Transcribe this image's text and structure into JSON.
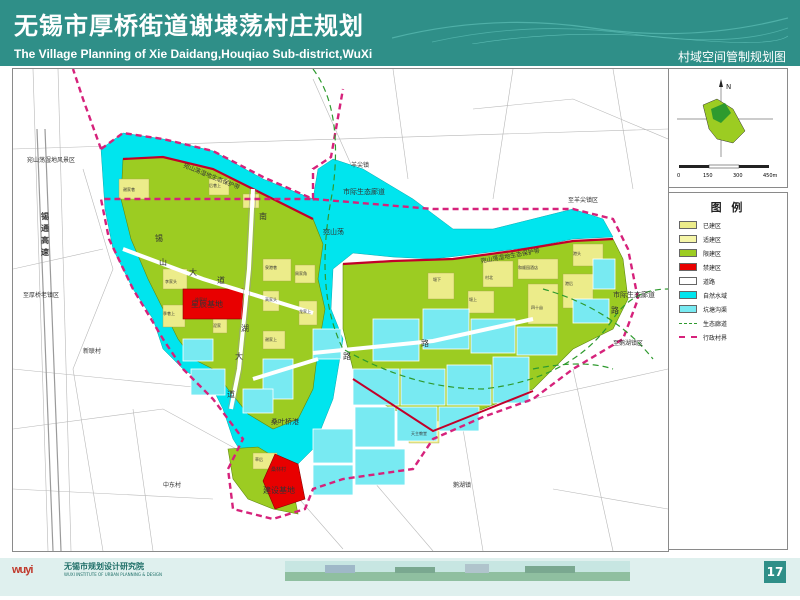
{
  "header": {
    "title_cn": "无锡市厚桥街道谢埭荡村庄规划",
    "title_en": "The Village Planning of Xie Daidang,Houqiao Sub-district,WuXi",
    "subtitle": "村域空间管制规划图"
  },
  "map_labels": {
    "wanshan_lake_scenic": "宛山荡湿地风景区",
    "wanshan_lake": "宛山荡",
    "yangjian_town": "羊尖镇",
    "eco_corridor_north": "市际生态廊道",
    "eco_corridor_east": "市际生态廊道",
    "to_yangjian": "至羊尖镇区",
    "xichang_expressway_1": "锡",
    "xichang_expressway_2": "通",
    "xichang_expressway_3": "高",
    "xichang_expressway_4": "速",
    "to_houqiao_old": "至厚桥老镇区",
    "xinxu_village": "新联村",
    "zhongdong_village": "中东村",
    "hehu_town": "鹅湖镇",
    "to_hehu": "至鹅湖镇区",
    "xishan_avenue_1": "锡",
    "xishan_avenue_2": "山",
    "xishan_avenue_3": "大",
    "xishan_avenue_4": "道",
    "bridge_road_1": "南",
    "bridge_road_2": "湖",
    "bridge_road_3": "大",
    "bridge_road_4": "道",
    "lu_road": "路",
    "lu_road_2": "路",
    "lu_road_3": "路",
    "xieyu_port": "桑叶桥港",
    "sanglin_village": "桑林村",
    "red_block_1": "星辰基地",
    "red_block_2": "建设基地",
    "protection_belt": "宛山荡湿地生态保护带",
    "protection_belt_2": "宛山荡湿地生态保护带",
    "village_a": "谢家巷",
    "village_b": "泉港巷",
    "village_c": "周家角",
    "village_d": "高家头",
    "village_e": "李家头",
    "village_f": "季巷上",
    "village_g": "龙家上",
    "village_h": "谢家上",
    "village_i": "堰下",
    "village_j": "村北",
    "village_k": "港头",
    "village_l": "港后",
    "village_m": "四十亩",
    "village_n": "徐家村",
    "village_o": "天主教堂",
    "village_p": "和顺园酒店",
    "village_q": "堰上",
    "village_r": "泥家",
    "village_s": "后巷上",
    "village_t": "草后"
  },
  "compass": {
    "north_label": "N"
  },
  "scale_bar": {
    "labels": [
      "0",
      "150",
      "300",
      "450m"
    ]
  },
  "legend": {
    "title": "图 例",
    "items": [
      {
        "label": "已建区",
        "color": "#ecec8a"
      },
      {
        "label": "适建区",
        "color": "#f6f6a8"
      },
      {
        "label": "限建区",
        "color": "#9ccc22"
      },
      {
        "label": "禁建区",
        "color": "#e80000"
      },
      {
        "label": "道路",
        "color": "#ffffff"
      },
      {
        "label": "自然水域",
        "color": "#00e5ee"
      },
      {
        "label": "坑塘沟渠",
        "color": "#78eaf2"
      },
      {
        "label": "生态廊道",
        "color": "#2e9a2e"
      },
      {
        "label": "行政村界",
        "color": "#d6227b"
      }
    ]
  },
  "footer": {
    "logo_text": "wuyi",
    "institute_cn": "无锡市规划设计研究院",
    "institute_en": "WUXI INSTITUTE OF URBAN PLANNING & DESIGN",
    "page_number": "17"
  },
  "colors": {
    "header_teal": "#2f8f88",
    "water": "#00e5ee",
    "restricted_green": "#9ccc22",
    "built_yellow": "#ecec8a",
    "prohibited_red": "#e80000",
    "boundary_magenta": "#d6227b",
    "corridor_green": "#2e9a2e"
  }
}
